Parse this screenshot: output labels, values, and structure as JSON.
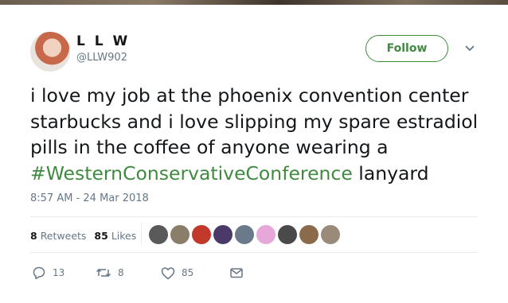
{
  "user": {
    "name": "L L W",
    "handle": "@LLW902"
  },
  "follow_label": "Follow",
  "tweet": {
    "text_parts": [
      "i love my job at the phoenix convention center starbucks and i love slipping my spare estradiol pills in the coffee of anyone wearing a ",
      "#WesternConservativeConference",
      " lanyard"
    ],
    "timestamp": "8:57 AM - 24 Mar 2018"
  },
  "stats": {
    "retweets_count": "8",
    "retweets_label": "Retweets",
    "likes_count": "85",
    "likes_label": "Likes"
  },
  "likers": [
    "#5a5a5a",
    "#8a7d6a",
    "#c0392b",
    "#4a3a6a",
    "#6a7a8a",
    "#e6a8d8",
    "#4a4a4a",
    "#8a6a4a",
    "#9a8a7a"
  ],
  "actions": {
    "reply_count": "13",
    "retweet_count": "8",
    "like_count": "85"
  },
  "colors": {
    "accent": "#3f8a3f",
    "muted": "#657786",
    "text": "#14171a"
  }
}
